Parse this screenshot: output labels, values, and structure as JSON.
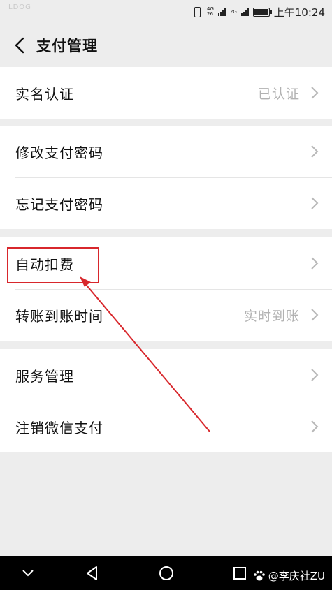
{
  "status_bar": {
    "left_text": "LDOG",
    "network_top": "4G",
    "network_bottom": "26",
    "network2": "2G",
    "time": "上午10:24"
  },
  "header": {
    "title": "支付管理"
  },
  "groups": [
    {
      "rows": [
        {
          "label": "实名认证",
          "value": "已认证"
        }
      ]
    },
    {
      "rows": [
        {
          "label": "修改支付密码",
          "value": ""
        },
        {
          "label": "忘记支付密码",
          "value": ""
        }
      ]
    },
    {
      "rows": [
        {
          "label": "自动扣费",
          "value": ""
        },
        {
          "label": "转账到账时间",
          "value": "实时到账"
        }
      ]
    },
    {
      "rows": [
        {
          "label": "服务管理",
          "value": ""
        },
        {
          "label": "注销微信支付",
          "value": ""
        }
      ]
    }
  ],
  "annotation": {
    "color": "#d8272c"
  },
  "watermark": {
    "text": "@李庆社ZU"
  },
  "icons": [
    "back-icon",
    "chevron-right-icon",
    "vibrate-icon",
    "signal-icon",
    "battery-icon",
    "nav-back-icon",
    "nav-home-icon",
    "nav-recents-icon",
    "nav-collapse-icon"
  ]
}
